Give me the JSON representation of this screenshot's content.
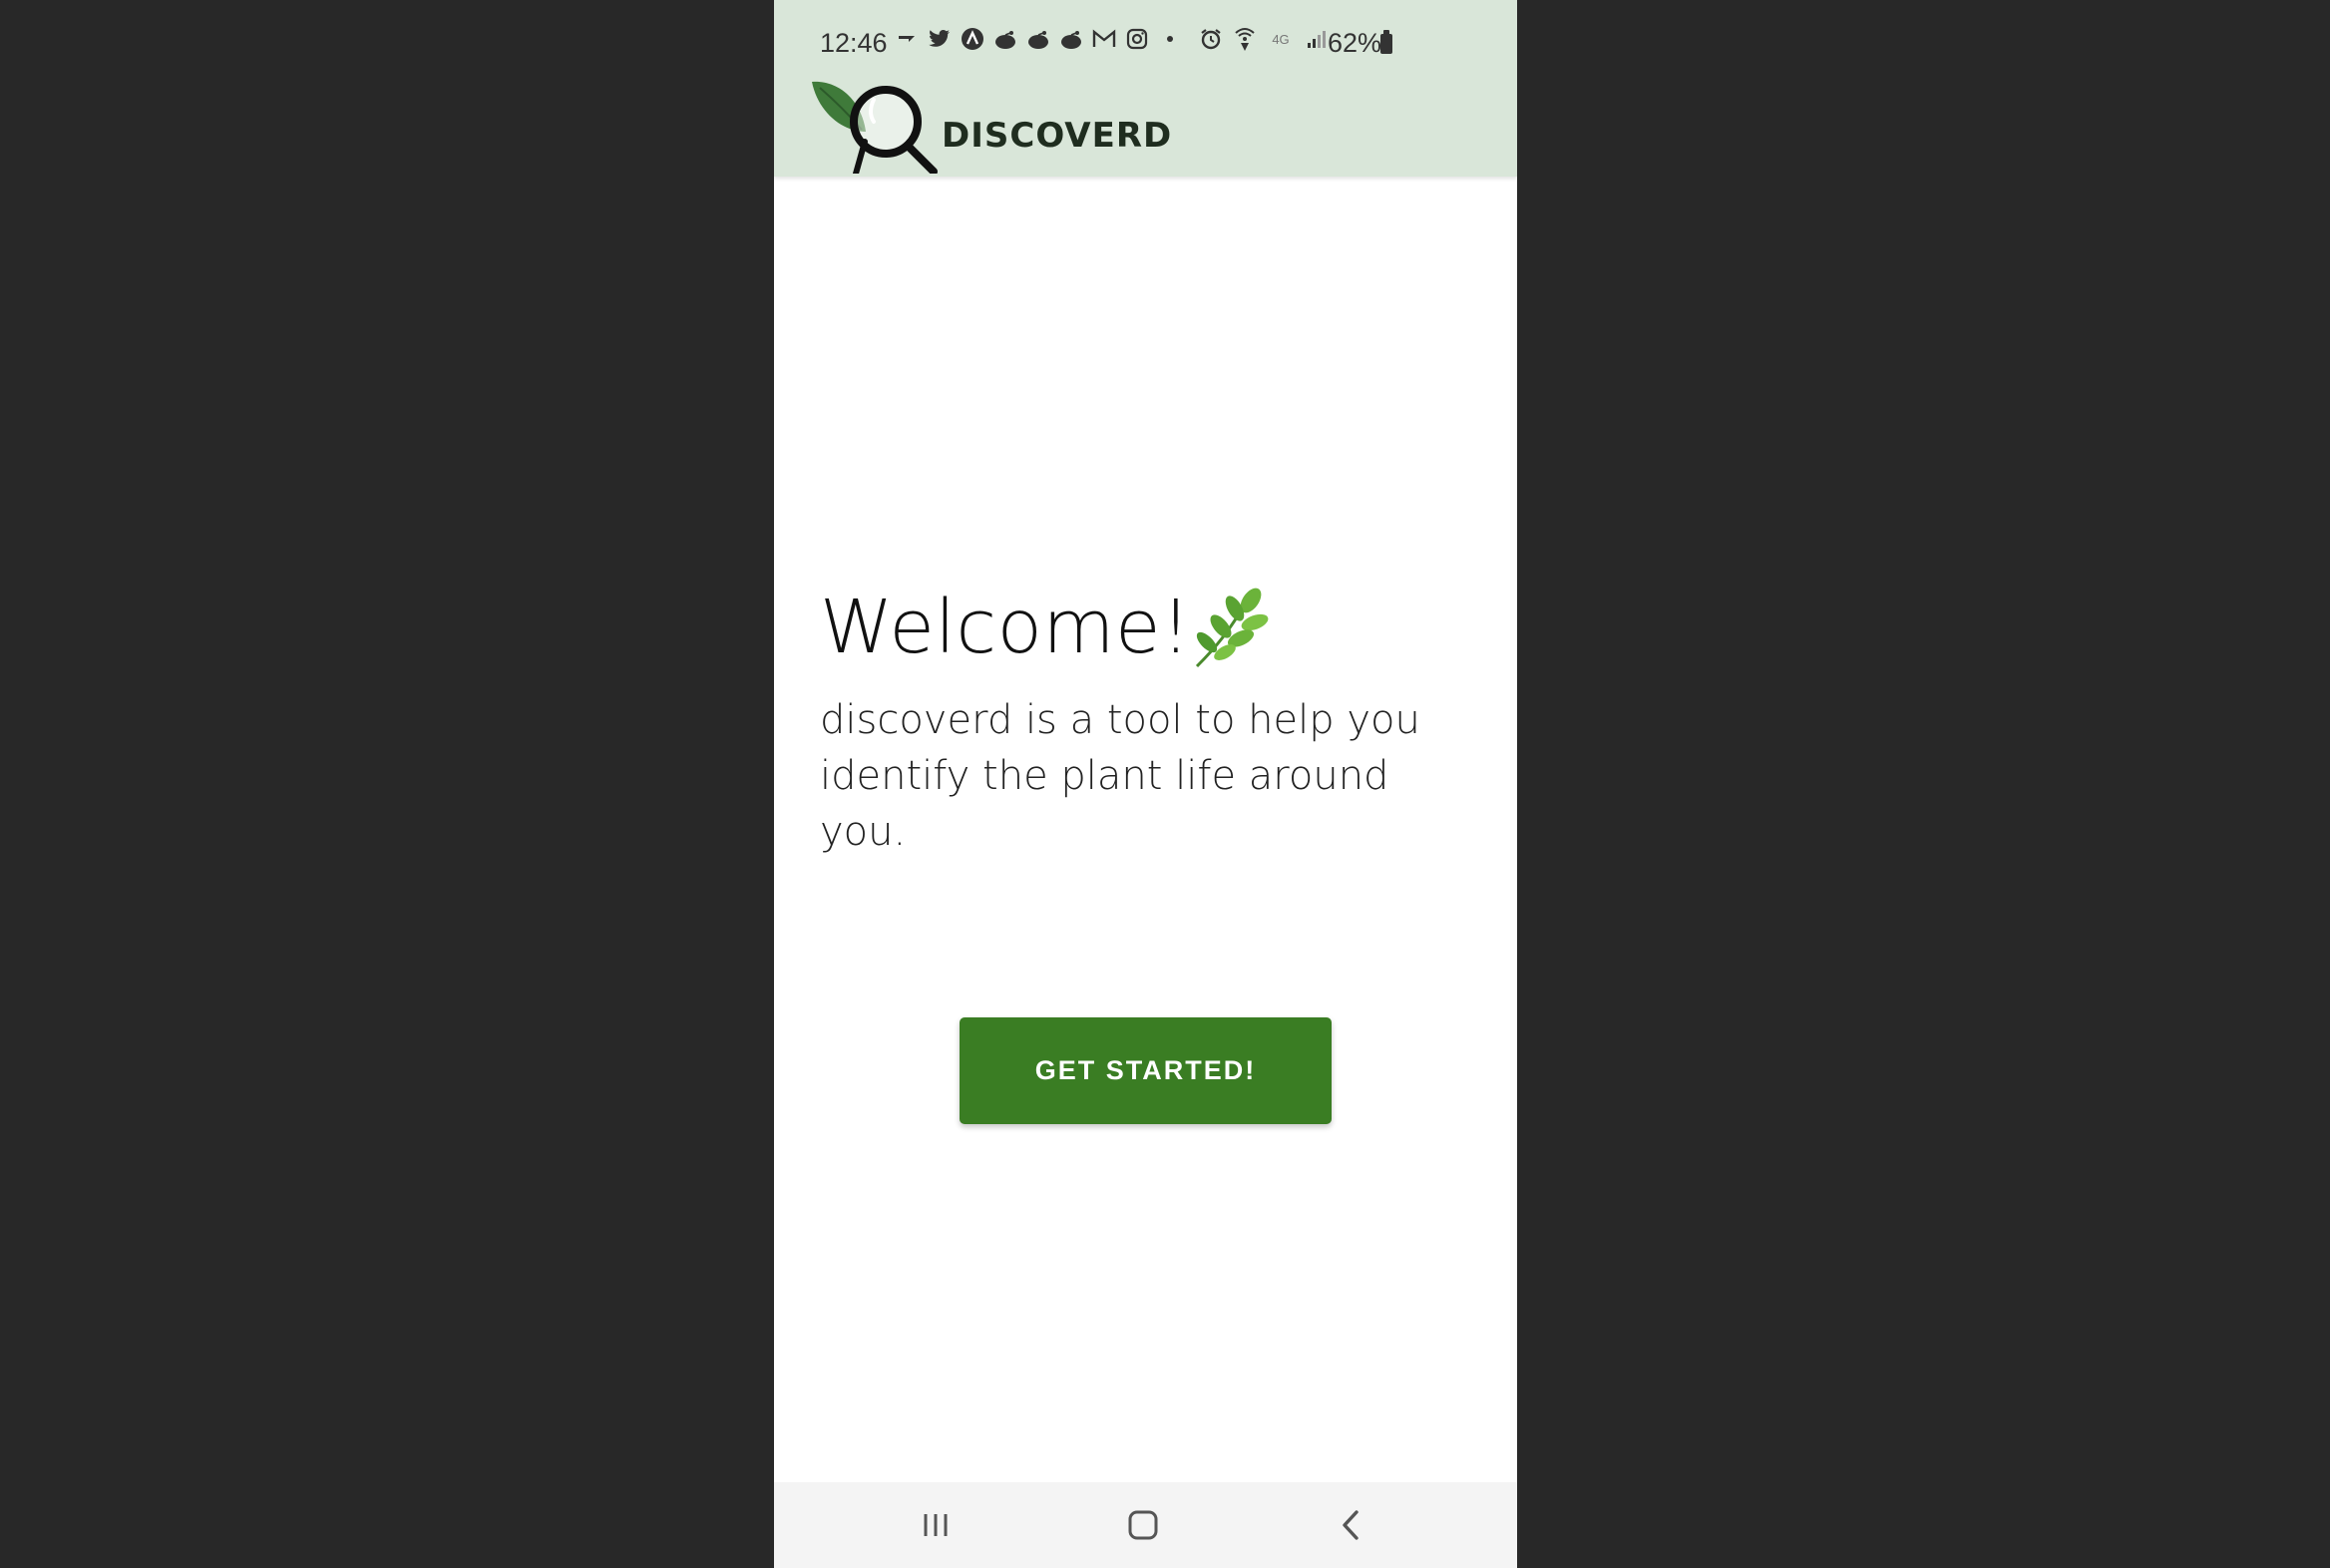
{
  "status_bar": {
    "time": "12:46",
    "battery_percent": "62%",
    "network": "4G",
    "left_icons": [
      "navigation-arrow-icon",
      "twitter-icon",
      "app-a-icon",
      "reddit-icon",
      "reddit-icon",
      "reddit-icon",
      "gmail-icon",
      "instagram-icon",
      "dot-icon"
    ],
    "right_icons": [
      "alarm-icon",
      "wifi-calling-icon",
      "network-4g-icon",
      "signal-icon",
      "battery-icon"
    ]
  },
  "app_bar": {
    "brand": "DISCOVERD",
    "logo_icon": "leaf-magnifier-logo"
  },
  "welcome": {
    "title": "Welcome!",
    "emoji_icon": "herb-leaf-icon",
    "description": "discoverd is a tool to help you identify the plant life around you."
  },
  "cta": {
    "label": "GET STARTED!"
  },
  "nav_bar": {
    "items": [
      "recents-icon",
      "home-icon",
      "back-icon"
    ]
  },
  "colors": {
    "background_outer": "#282828",
    "header_bg": "#d9e6d9",
    "button_bg": "#3a7d23",
    "button_text": "#ffffff",
    "nav_bg": "#f4f4f4"
  }
}
